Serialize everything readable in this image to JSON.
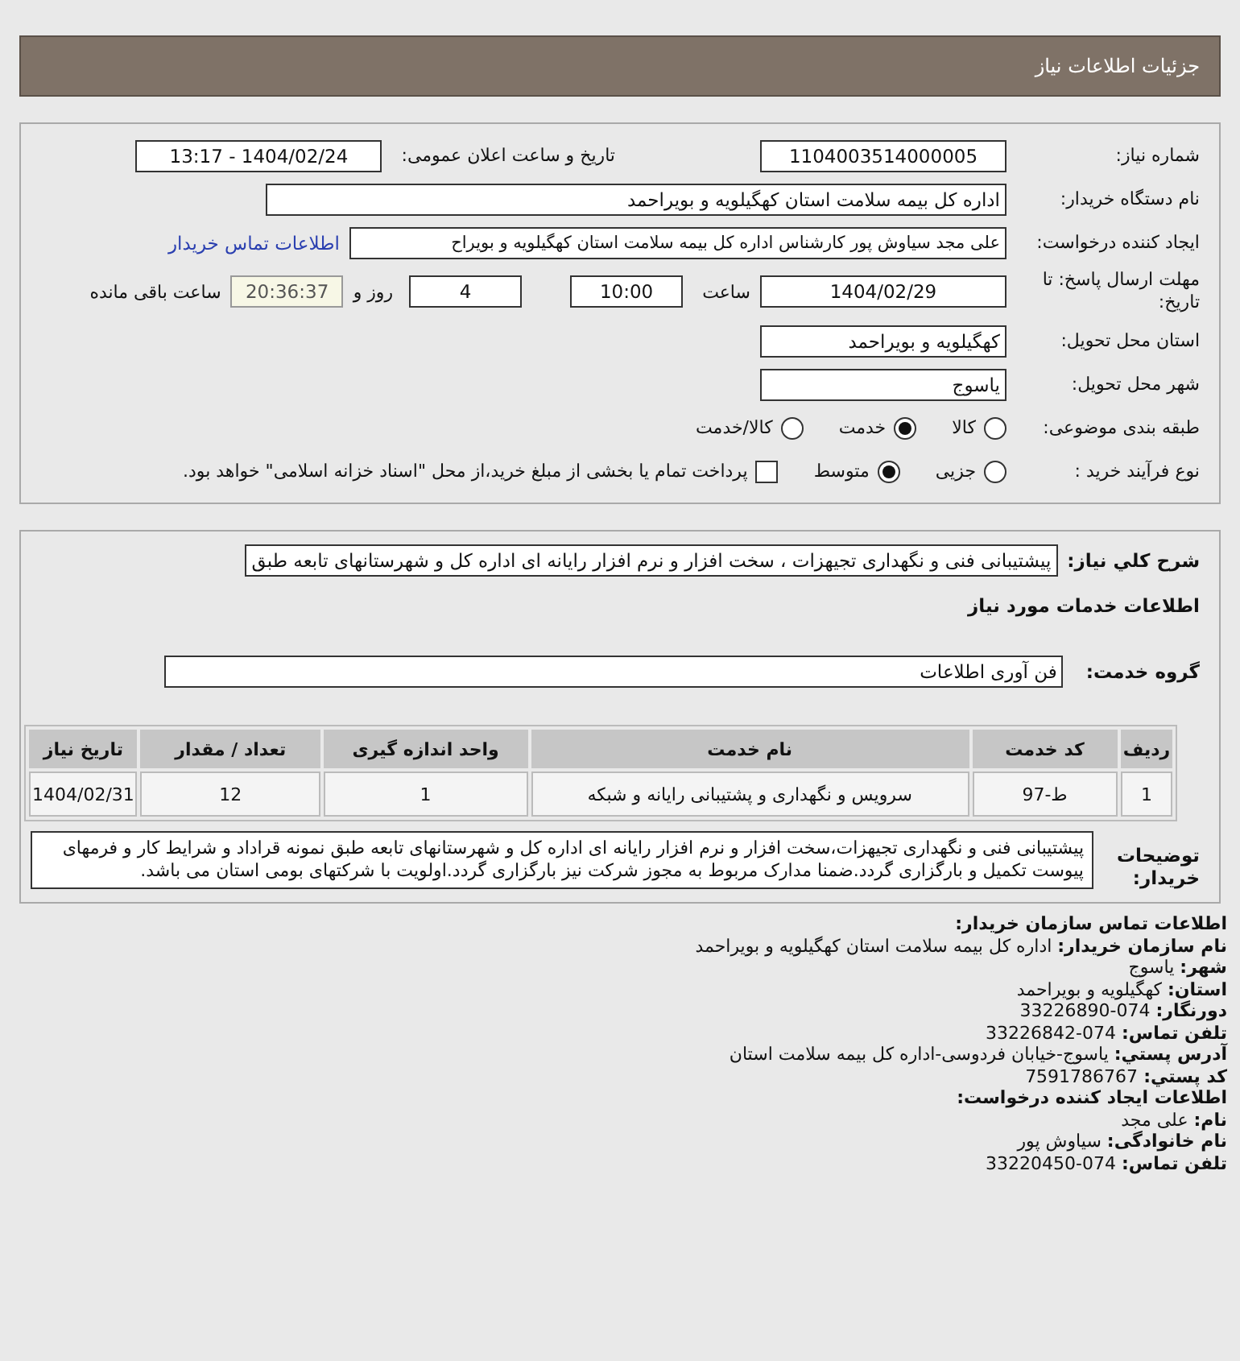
{
  "page_title": "جزئیات اطلاعات نیاز",
  "need_number": {
    "label": "شماره نیاز:",
    "value": "1104003514000005"
  },
  "announce": {
    "label": "تاریخ و ساعت اعلان عمومی:",
    "value": "1404/02/24 - 13:17"
  },
  "buyer_org": {
    "label": "نام دستگاه خریدار:",
    "value": "اداره کل بیمه سلامت استان کهگیلویه و بویراحمد"
  },
  "requester": {
    "label": "ایجاد کننده درخواست:",
    "value": "علی مجد سیاوش پور کارشناس اداره کل بیمه سلامت استان کهگیلویه و بویراح",
    "link": "اطلاعات تماس خریدار"
  },
  "deadline": {
    "label": "مهلت ارسال پاسخ: تا تاریخ:",
    "date": "1404/02/29",
    "time_label": "ساعت",
    "time": "10:00",
    "days": "4",
    "days_label": "روز و",
    "remaining": "20:36:37",
    "remaining_label": "ساعت باقی مانده"
  },
  "province": {
    "label": "استان محل تحویل:",
    "value": "کهگیلویه و بویراحمد"
  },
  "city": {
    "label": "شهر محل تحویل:",
    "value": "یاسوج"
  },
  "category": {
    "label": "طبقه بندی موضوعی:",
    "options": [
      {
        "label": "کالا",
        "selected": false
      },
      {
        "label": "خدمت",
        "selected": true
      },
      {
        "label": "کالا/خدمت",
        "selected": false
      }
    ]
  },
  "process": {
    "label": "نوع فرآیند خرید :",
    "options": [
      {
        "label": "جزیی",
        "selected": false
      },
      {
        "label": "متوسط",
        "selected": true
      }
    ],
    "payment": {
      "checked": false,
      "label": "پرداخت تمام یا بخشی از مبلغ خرید،از محل \"اسناد خزانه اسلامی\" خواهد بود."
    }
  },
  "summary": {
    "label": "شرح کلي نیاز:",
    "value": "پیشتیبانی فنی و نگهداری تجیهزات ، سخت افزار و نرم افزار رایانه ای اداره کل و شهرستانهای تابعه طبق"
  },
  "services_heading": "اطلاعات خدمات مورد نیاز",
  "service_group": {
    "label": "گروه خدمت:",
    "value": "فن آوری اطلاعات"
  },
  "table": {
    "columns": [
      "ردیف",
      "کد خدمت",
      "نام خدمت",
      "واحد اندازه گیری",
      "تعداد / مقدار",
      "تاریخ نیاز"
    ],
    "rows": [
      [
        "1",
        "ط-97",
        "سرویس و نگهداری و پشتیبانی رایانه و شبکه",
        "1",
        "12",
        "1404/02/31"
      ]
    ]
  },
  "buyer_notes": {
    "label": "توضیحات خریدار:",
    "text": "پیشتیبانی فنی و نگهداری تجیهزات،سخت افزار و نرم افزار رایانه ای اداره کل و شهرستانهای تابعه طبق نمونه قراداد و شرایط کار و فرمهای پیوست تکمیل و بارگزاری گردد.ضمنا مدارک مربوط به مجوز شرکت نیز بارگزاری گردد.اولویت با شرکتهای بومی استان می باشد."
  },
  "contact": {
    "heading": "اطلاعات تماس سازمان خریدار:",
    "lines": [
      {
        "label": "نام سازمان خریدار:",
        "value": "اداره کل بیمه سلامت استان کهگیلویه و بویراحمد"
      },
      {
        "label": "شهر:",
        "value": "یاسوج"
      },
      {
        "label": "استان:",
        "value": "کهگیلویه و بویراحمد"
      },
      {
        "label": "دورنگار:",
        "value": "074-33226890"
      },
      {
        "label": "تلفن تماس:",
        "value": "074-33226842"
      },
      {
        "label": "آدرس پستي:",
        "value": "یاسوج-خیابان فردوسی-اداره کل بیمه سلامت استان"
      },
      {
        "label": "کد پستي:",
        "value": "7591786767"
      }
    ],
    "creator_heading": "اطلاعات ایجاد کننده درخواست:",
    "creator_lines": [
      {
        "label": "نام:",
        "value": "علی مجد"
      },
      {
        "label": "نام خانوادگی:",
        "value": "سیاوش پور"
      },
      {
        "label": "تلفن تماس:",
        "value": "074-33220450"
      }
    ]
  }
}
